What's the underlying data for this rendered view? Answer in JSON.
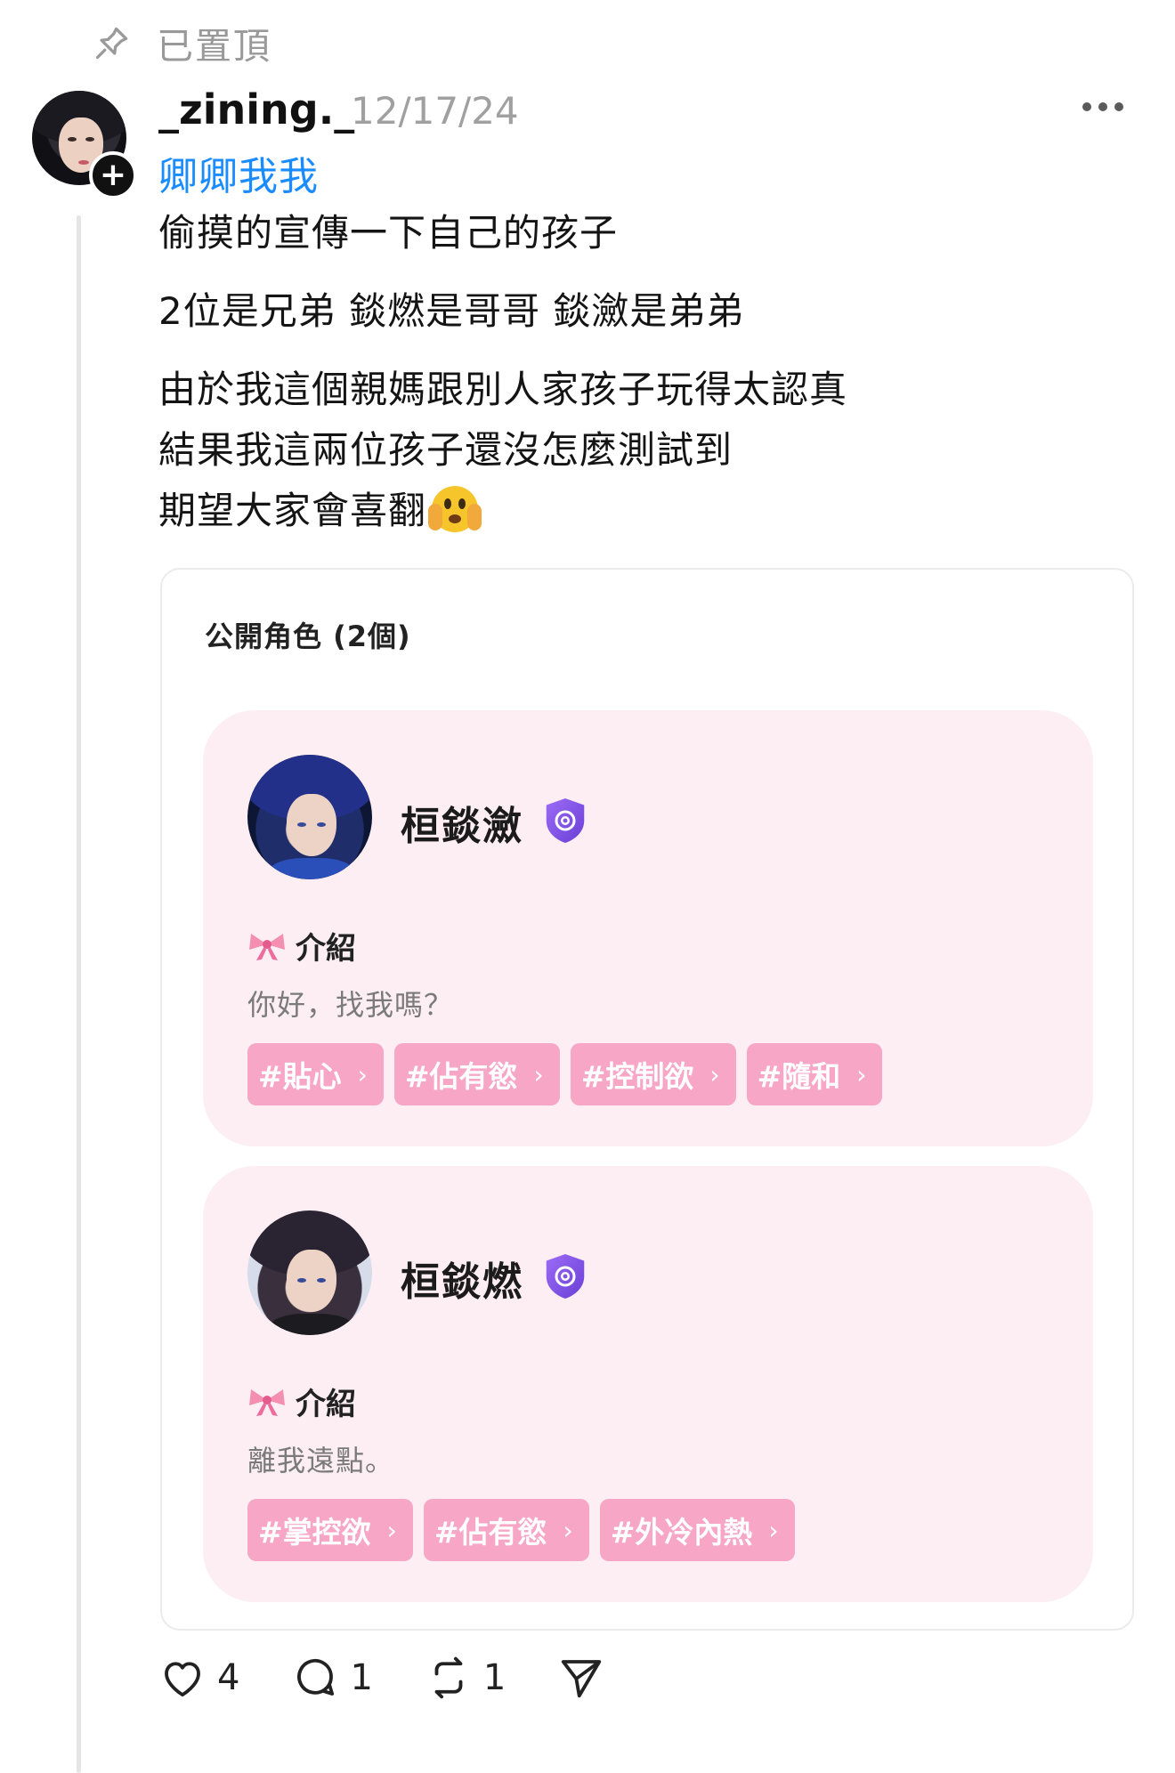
{
  "pinned": {
    "label": "已置頂",
    "icon": "pin-icon"
  },
  "post": {
    "username": "_zining._",
    "date": "12/17/24",
    "tag": "卿卿我我",
    "lines": [
      "偷摸的宣傳一下自己的孩子",
      "2位是兄弟 錟燃是哥哥 錟瀲是弟弟",
      "由於我這個親媽跟別人家孩子玩得太認真",
      "結果我這兩位孩子還沒怎麼測試到",
      "期望大家會喜翻"
    ],
    "emoji": "face-with-hand-over-mouth-emoji"
  },
  "card": {
    "title": "公開角色 (2個)",
    "characters": [
      {
        "name": "桓錟瀲",
        "intro_label": "介紹",
        "intro_text": "你好，找我嗎？",
        "tags": [
          "#貼心",
          "#佔有慾",
          "#控制欲",
          "#隨和"
        ]
      },
      {
        "name": "桓錟燃",
        "intro_label": "介紹",
        "intro_text": "離我遠點。",
        "tags": [
          "#掌控欲",
          "#佔有慾",
          "#外冷內熱"
        ]
      }
    ]
  },
  "actions": {
    "likes": "4",
    "comments": "1",
    "reposts": "1"
  },
  "colors": {
    "link": "#1a8cff",
    "tag_bg": "#f7a6c6",
    "panel_bg": "#fdeef3",
    "verified": "#7b4fe0"
  }
}
